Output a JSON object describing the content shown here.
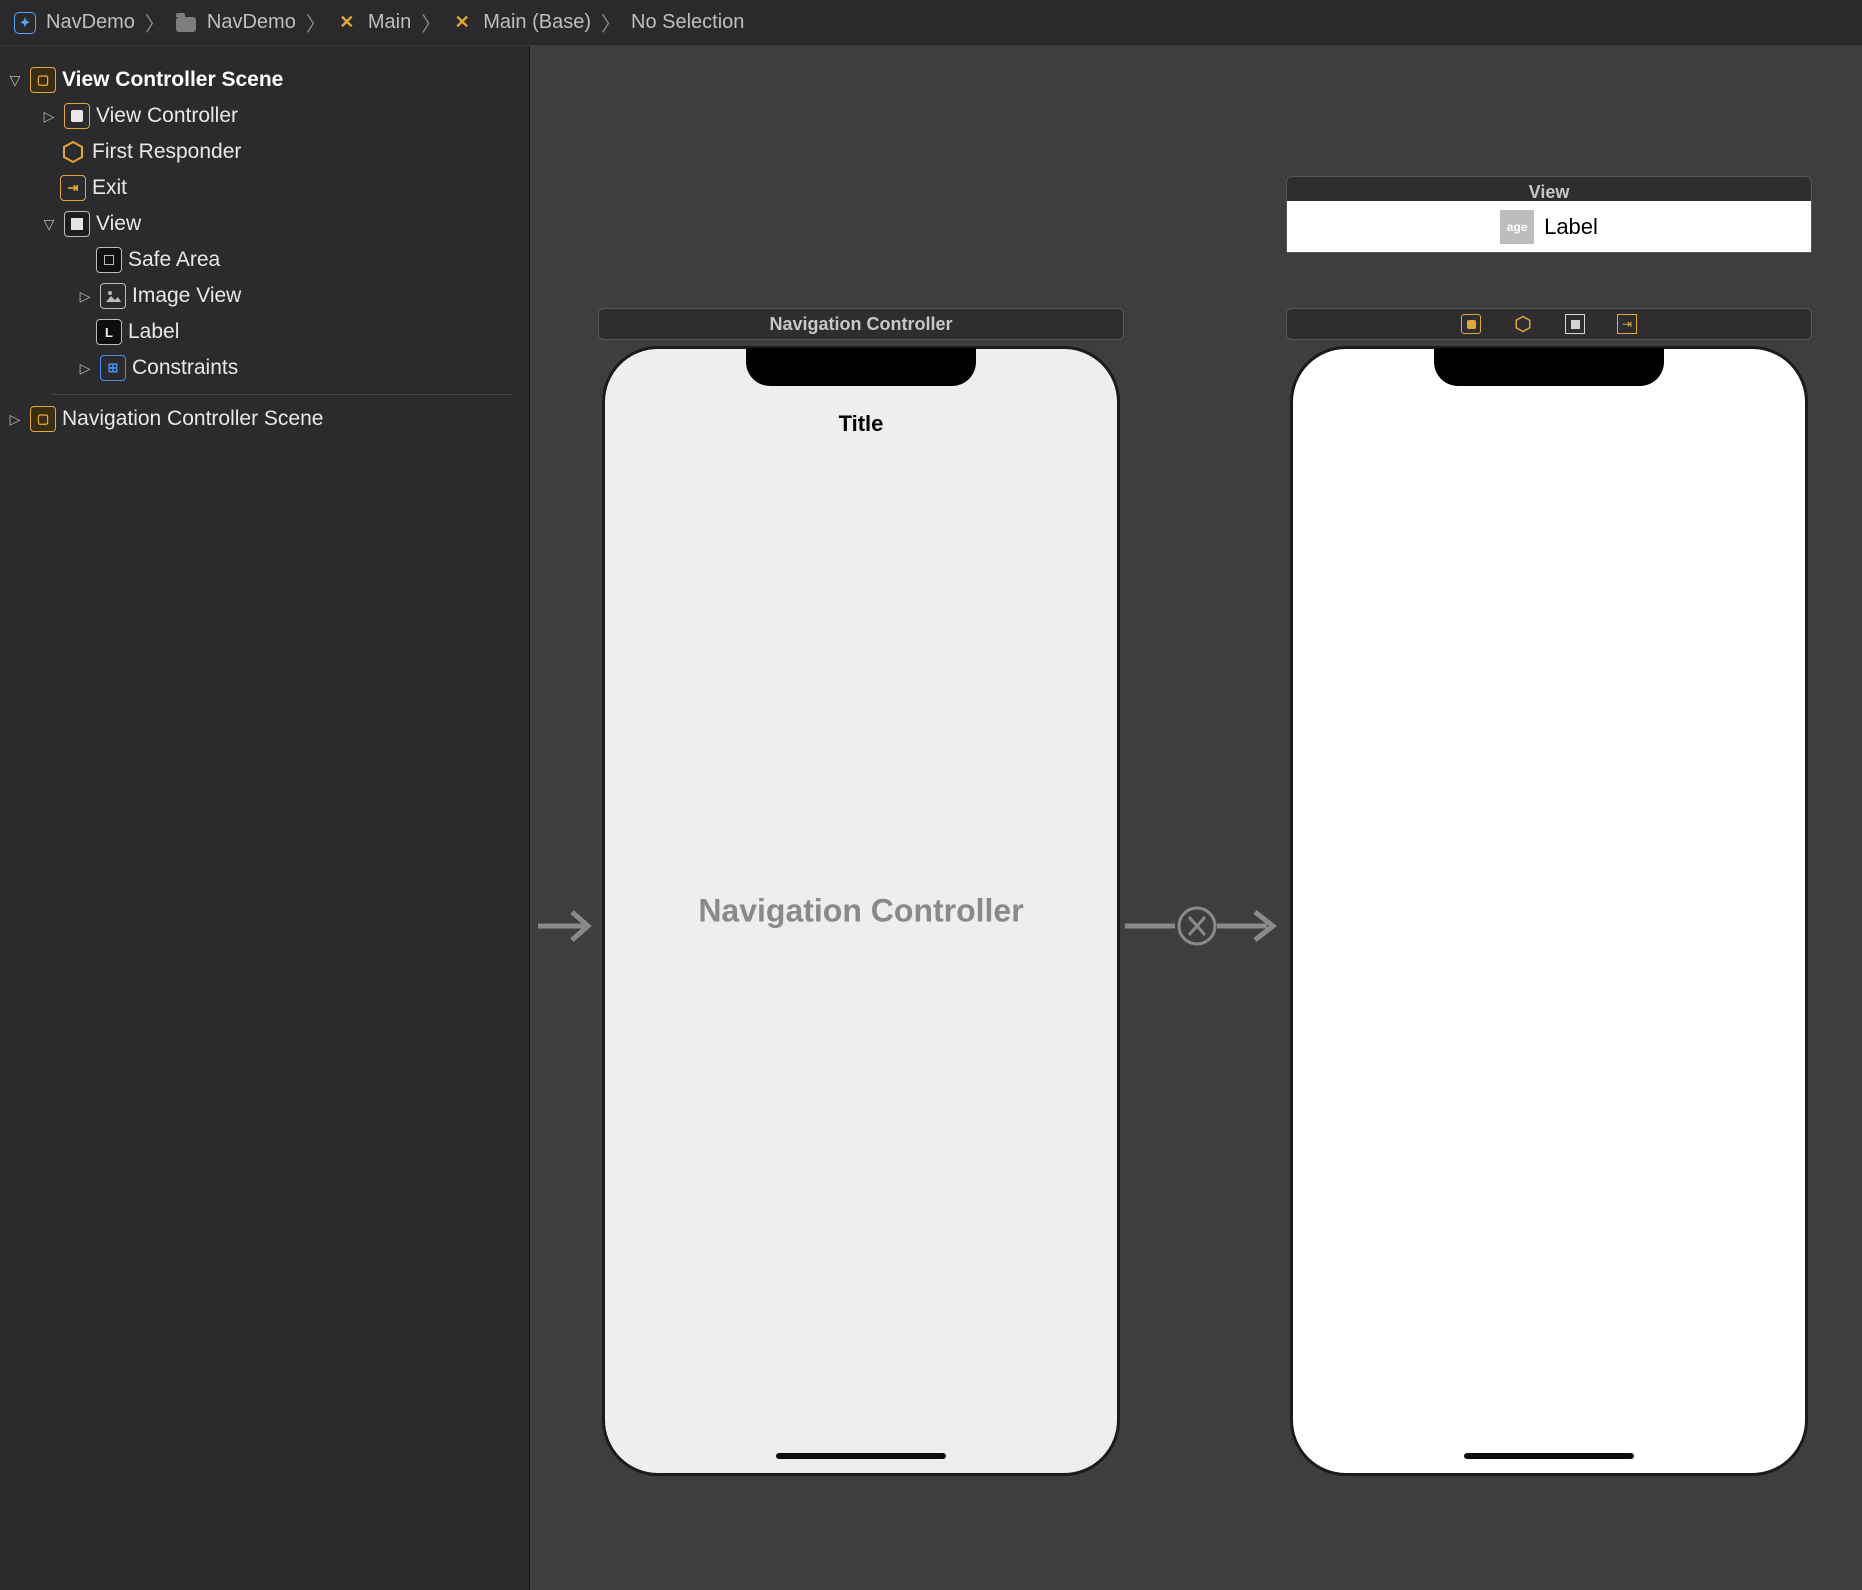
{
  "breadcrumb": {
    "project": "NavDemo",
    "folder": "NavDemo",
    "storyboard": "Main",
    "base": "Main (Base)",
    "selection": "No Selection"
  },
  "outline": {
    "scene1": {
      "title": "View Controller Scene",
      "items": {
        "vc": "View Controller",
        "first": "First Responder",
        "exit": "Exit",
        "view": "View",
        "safe": "Safe Area",
        "image": "Image View",
        "label": "Label",
        "constraints": "Constraints"
      }
    },
    "scene2": {
      "title": "Navigation Controller Scene"
    }
  },
  "canvas": {
    "navController": {
      "header": "Navigation Controller",
      "title": "Title",
      "centerText": "Navigation Controller"
    },
    "view": {
      "header": "View",
      "labelThumb": "age",
      "labelText": "Label"
    }
  }
}
